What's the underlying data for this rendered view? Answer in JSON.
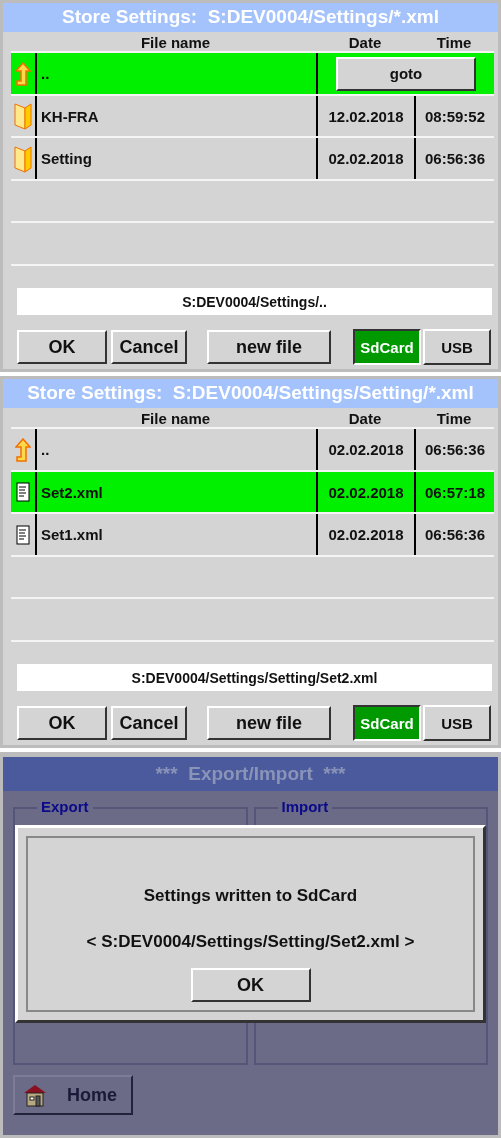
{
  "browsers": [
    {
      "title": "Store Settings:  S:DEV0004/Settings/*.xml",
      "columns": [
        "File name",
        "Date",
        "Time"
      ],
      "rows": [
        {
          "kind": "up",
          "name": "..",
          "action": "goto",
          "selected": true
        },
        {
          "kind": "folder",
          "name": "KH-FRA",
          "date": "12.02.2018",
          "time": "08:59:52",
          "selected": false
        },
        {
          "kind": "folder",
          "name": "Setting",
          "date": "02.02.2018",
          "time": "06:56:36",
          "selected": false
        }
      ],
      "path": "S:DEV0004/Settings/..",
      "buttons": [
        "OK",
        "Cancel",
        "new file"
      ],
      "storage": [
        {
          "label": "SdCard",
          "selected": true
        },
        {
          "label": "USB",
          "selected": false
        }
      ]
    },
    {
      "title": "Store Settings:  S:DEV0004/Settings/Setting/*.xml",
      "columns": [
        "File name",
        "Date",
        "Time"
      ],
      "rows": [
        {
          "kind": "up",
          "name": "..",
          "date": "02.02.2018",
          "time": "06:56:36",
          "selected": false
        },
        {
          "kind": "file",
          "name": "Set2.xml",
          "date": "02.02.2018",
          "time": "06:57:18",
          "selected": true
        },
        {
          "kind": "file",
          "name": "Set1.xml",
          "date": "02.02.2018",
          "time": "06:56:36",
          "selected": false
        }
      ],
      "path": "S:DEV0004/Settings/Setting/Set2.xml",
      "buttons": [
        "OK",
        "Cancel",
        "new file"
      ],
      "storage": [
        {
          "label": "SdCard",
          "selected": true
        },
        {
          "label": "USB",
          "selected": false
        }
      ]
    }
  ],
  "export_import": {
    "title": "***  Export/Import  ***",
    "groups": [
      "Export",
      "Import"
    ],
    "dialog": {
      "message": "Settings written to SdCard",
      "path": "< S:DEV0004/Settings/Setting/Set2.xml >",
      "button": "OK"
    },
    "home_button": "Home"
  }
}
